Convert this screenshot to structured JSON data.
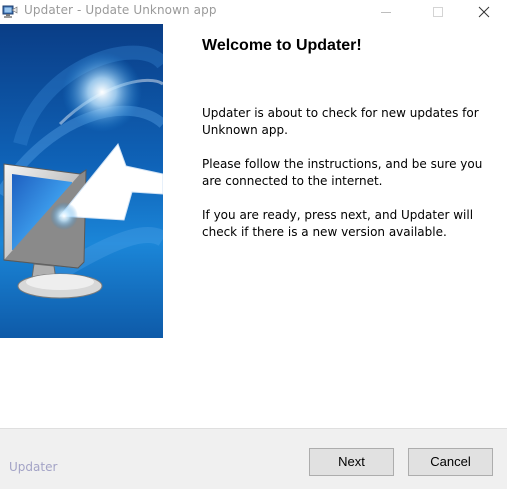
{
  "window": {
    "title": "Updater - Update Unknown app"
  },
  "content": {
    "heading": "Welcome to Updater!",
    "paragraph1": "Updater is about to check for new updates for Unknown app.",
    "paragraph2": "Please follow the instructions, and be sure you are connected to the internet.",
    "paragraph3": "If you are ready, press next, and Updater will check if there is a new version available."
  },
  "footer": {
    "brand": "Updater",
    "next_label": "Next",
    "cancel_label": "Cancel"
  },
  "icons": {
    "app": "updater-app-icon",
    "banner": "monitor-arrow-illustration"
  },
  "colors": {
    "title_text": "#9a9a9a",
    "banner_blue": "#0f63b8",
    "footer_bg": "#f0f0f0",
    "brand_text": "#a3a3c6",
    "button_bg": "#e1e1e1"
  }
}
